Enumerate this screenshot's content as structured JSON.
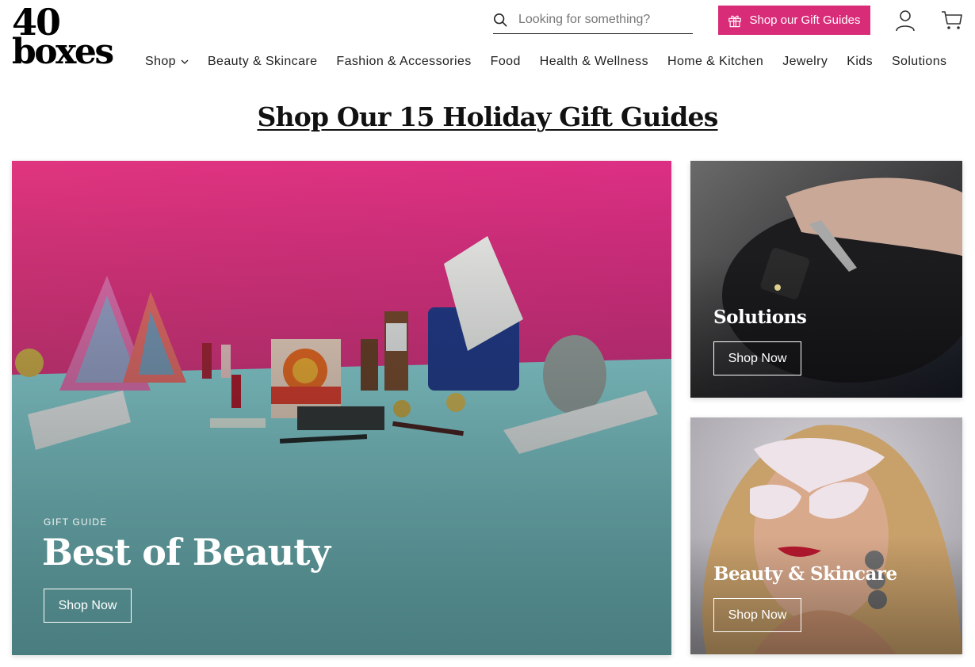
{
  "brand": {
    "logo_line1": "40",
    "logo_line2": "boxes"
  },
  "header": {
    "search": {
      "placeholder": "Looking for something?",
      "value": "",
      "icon": "search-icon"
    },
    "gift_button": {
      "label": "Shop our Gift Guides",
      "icon": "gift-icon",
      "color": "#d92c78"
    },
    "account_icon": "user-icon",
    "cart_icon": "cart-icon"
  },
  "nav": {
    "items": [
      {
        "label": "Shop",
        "has_dropdown": true
      },
      {
        "label": "Beauty & Skincare"
      },
      {
        "label": "Fashion & Accessories"
      },
      {
        "label": "Food"
      },
      {
        "label": "Health & Wellness"
      },
      {
        "label": "Home & Kitchen"
      },
      {
        "label": "Jewelry"
      },
      {
        "label": "Kids"
      },
      {
        "label": "Solutions"
      }
    ]
  },
  "main": {
    "title": "Shop Our 15 Holiday Gift Guides",
    "featured": {
      "eyebrow": "GIFT GUIDE",
      "headline": "Best of Beauty",
      "button": "Shop Now",
      "image_alt": "Beauty products on pink and teal backdrop"
    },
    "side_cards": [
      {
        "headline": "Solutions",
        "button": "Shop Now",
        "image_alt": "Hand holding keychain with flashlight on black bag"
      },
      {
        "headline": "Beauty & Skincare",
        "button": "Shop Now",
        "image_alt": "Woman wearing glitter face mask"
      }
    ]
  }
}
